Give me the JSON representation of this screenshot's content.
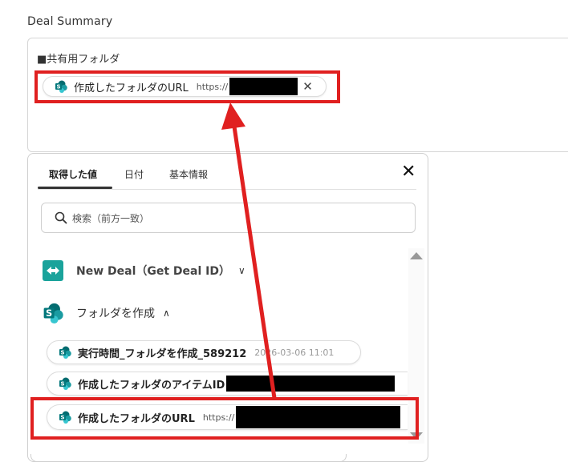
{
  "field": {
    "label": "Deal Summary",
    "content": "■共有用フォルダ"
  },
  "top_chip": {
    "icon": "sharepoint-icon",
    "label": "作成したフォルダのURL",
    "url_prefix": "https://",
    "remove_icon": "✕"
  },
  "panel": {
    "tabs": [
      "取得した値",
      "日付",
      "基本情報"
    ],
    "active_tab": "取得した値",
    "close_icon": "✕",
    "search_placeholder": "検索（前方一致）",
    "groups": [
      {
        "title": "New Deal（Get Deal ID）",
        "icon": "zoho-crm-icon",
        "expanded": false
      },
      {
        "title": "フォルダを作成",
        "icon": "sharepoint-icon",
        "expanded": true
      }
    ],
    "items": [
      {
        "label": "実行時間_フォルダを作成_589212",
        "value": "2026-03-06 11:01"
      },
      {
        "label": "作成したフォルダのアイテムID",
        "value": ""
      },
      {
        "label": "作成したフォルダのURL",
        "value": "https://"
      }
    ]
  },
  "colors": {
    "highlight": "#e02020",
    "redaction": "#000000",
    "sharepoint_teal": "#038387",
    "zoho_teal": "#1aa39b"
  }
}
